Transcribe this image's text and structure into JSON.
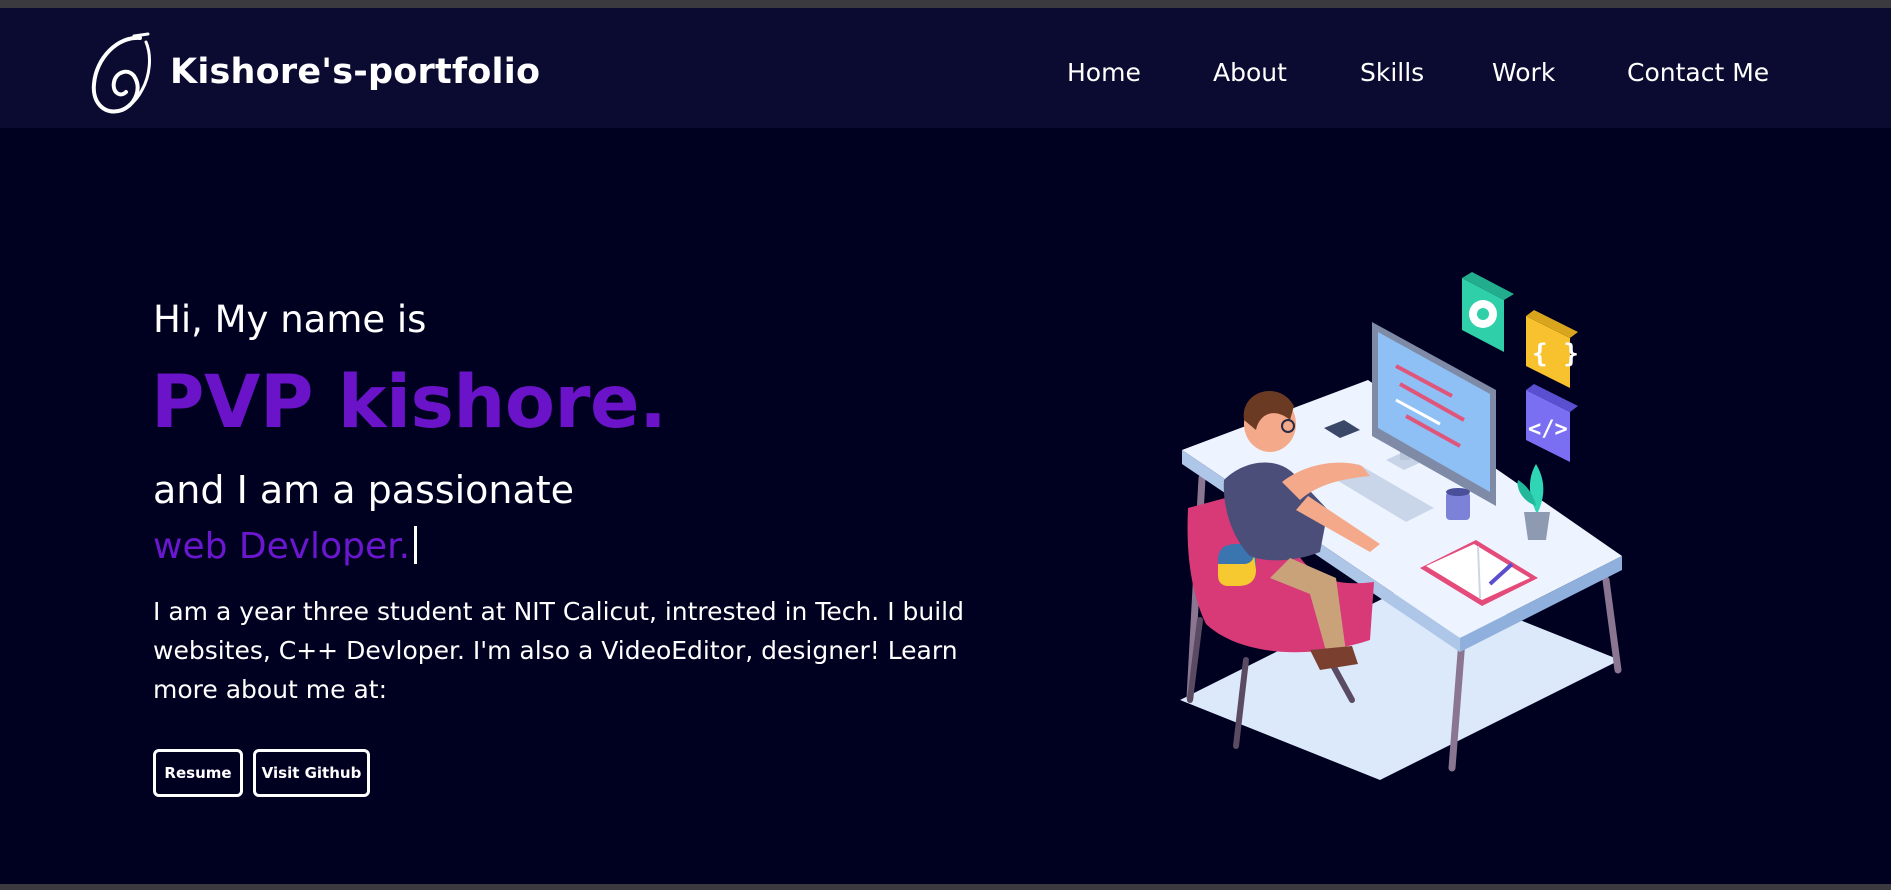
{
  "window": {
    "title": "Kishore's-portfolio"
  },
  "header": {
    "brand": "Kishore's-portfolio",
    "logo_icon": "swirl-logo-icon",
    "nav": [
      {
        "label": "Home"
      },
      {
        "label": "About"
      },
      {
        "label": "Skills"
      },
      {
        "label": "Work"
      },
      {
        "label": "Contact Me"
      }
    ]
  },
  "hero": {
    "greeting": "Hi, My name is",
    "name": "PVP kishore.",
    "intro": "and I am a passionate",
    "role": "web Devloper.",
    "bio": "I am a year three student at NIT Calicut, intrested in Tech. I build websites, C++ Devloper. I'm also a VideoEditor, designer! Learn more about me at:",
    "buttons": {
      "resume": "Resume",
      "github": "Visit Github"
    },
    "illustration": "developer-at-desk-illustration"
  },
  "colors": {
    "background": "#000020",
    "navbar": "#0b0b31",
    "accent": "#6a13c8",
    "text": "#ffffff"
  }
}
